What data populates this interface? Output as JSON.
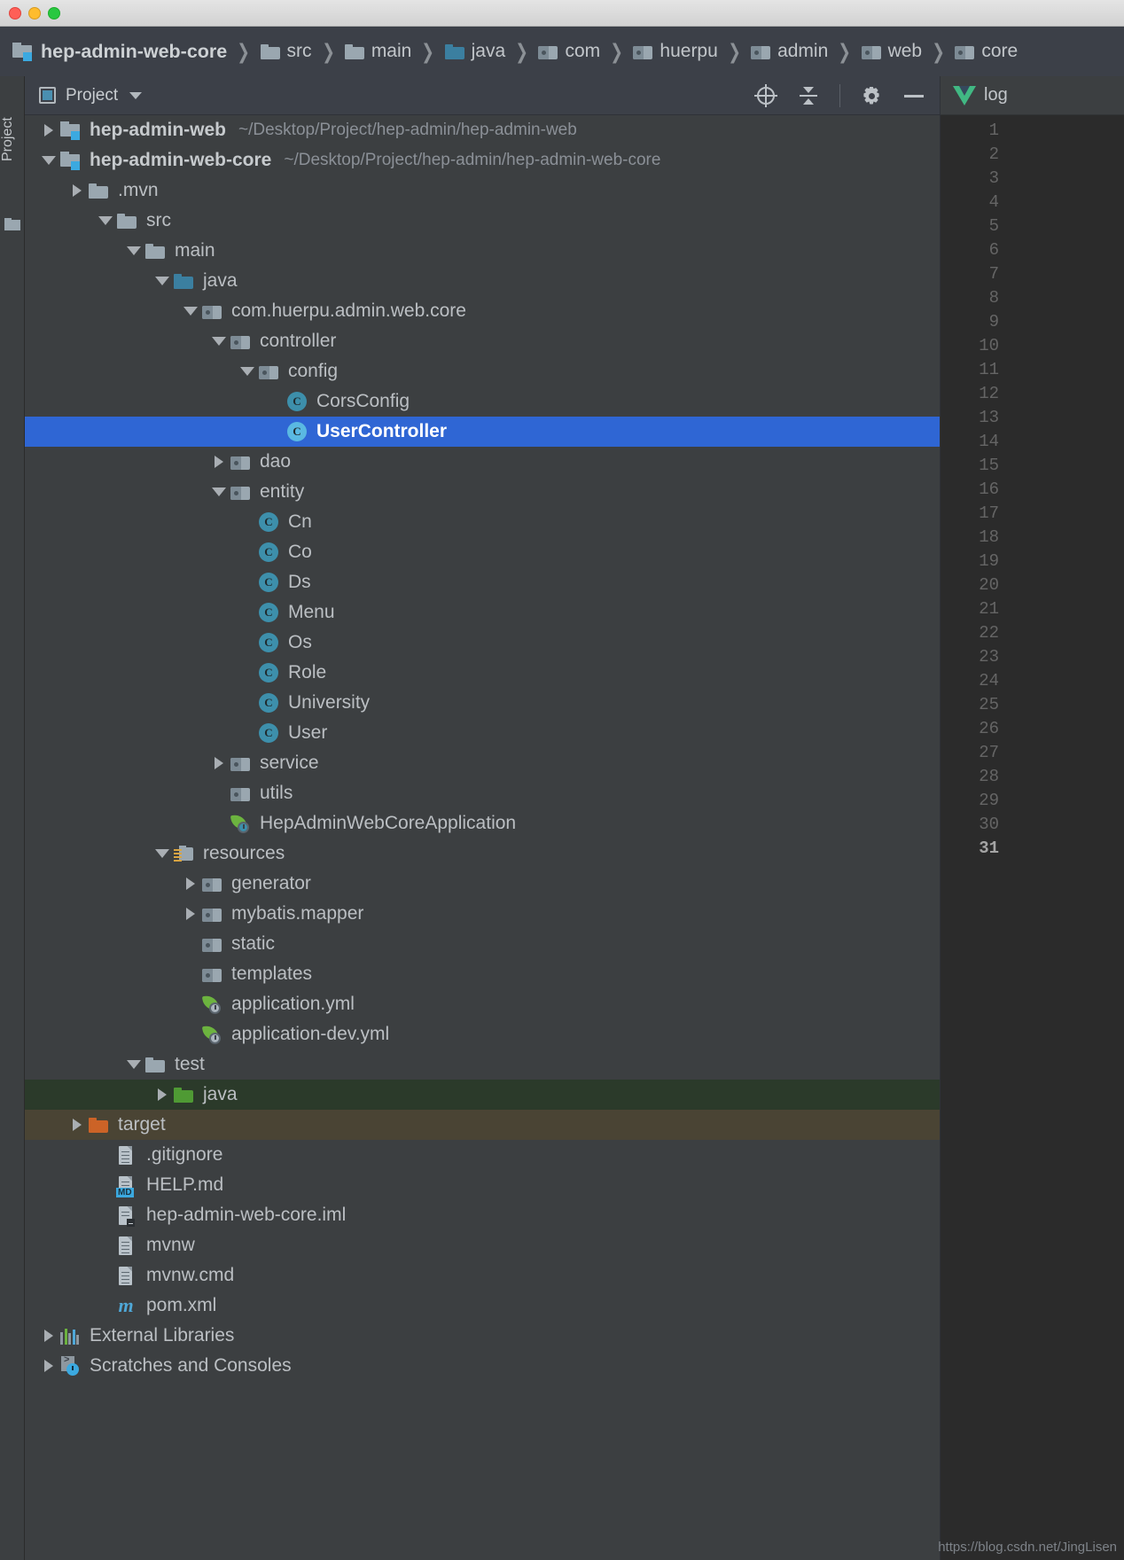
{
  "window": {
    "traffic_lights": [
      "close",
      "minimize",
      "zoom"
    ]
  },
  "breadcrumb": {
    "items": [
      {
        "label": "hep-admin-web-core",
        "icon": "module-icon",
        "root": true
      },
      {
        "label": "src",
        "icon": "folder-icon"
      },
      {
        "label": "main",
        "icon": "folder-icon"
      },
      {
        "label": "java",
        "icon": "source-folder-icon"
      },
      {
        "label": "com",
        "icon": "package-icon"
      },
      {
        "label": "huerpu",
        "icon": "package-icon"
      },
      {
        "label": "admin",
        "icon": "package-icon"
      },
      {
        "label": "web",
        "icon": "package-icon"
      },
      {
        "label": "core",
        "icon": "package-icon"
      }
    ],
    "separator": "❯"
  },
  "left_strip": {
    "tab_label": "Project"
  },
  "tool_window": {
    "title": "Project",
    "actions": [
      {
        "name": "locate-icon",
        "tooltip": "Select Opened File"
      },
      {
        "name": "collapse-all-icon",
        "tooltip": "Collapse All"
      },
      {
        "name": "gear-icon",
        "tooltip": "Settings"
      },
      {
        "name": "minimize-icon",
        "tooltip": "Hide"
      }
    ]
  },
  "tree": {
    "rows": [
      {
        "indent": 0,
        "arrow": "closed",
        "icon": "module-icon",
        "label": "hep-admin-web",
        "bold": true,
        "sub": "~/Desktop/Project/hep-admin/hep-admin-web"
      },
      {
        "indent": 0,
        "arrow": "open",
        "icon": "module-icon",
        "label": "hep-admin-web-core",
        "bold": true,
        "sub": "~/Desktop/Project/hep-admin/hep-admin-web-core"
      },
      {
        "indent": 1,
        "arrow": "closed",
        "icon": "folder-icon",
        "label": ".mvn"
      },
      {
        "indent": 2,
        "arrow": "open",
        "icon": "folder-icon",
        "label": "src"
      },
      {
        "indent": 3,
        "arrow": "open",
        "icon": "folder-icon",
        "label": "main"
      },
      {
        "indent": 4,
        "arrow": "open",
        "icon": "source-folder-icon",
        "label": "java"
      },
      {
        "indent": 5,
        "arrow": "open",
        "icon": "package-icon",
        "label": "com.huerpu.admin.web.core"
      },
      {
        "indent": 6,
        "arrow": "open",
        "icon": "package-icon",
        "label": "controller"
      },
      {
        "indent": 7,
        "arrow": "open",
        "icon": "package-icon",
        "label": "config"
      },
      {
        "indent": 8,
        "arrow": "none",
        "icon": "class-icon",
        "label": "CorsConfig"
      },
      {
        "indent": 8,
        "arrow": "none",
        "icon": "class-icon",
        "label": "UserController",
        "selected": true
      },
      {
        "indent": 6,
        "arrow": "closed",
        "icon": "package-icon",
        "label": "dao"
      },
      {
        "indent": 6,
        "arrow": "open",
        "icon": "package-icon",
        "label": "entity"
      },
      {
        "indent": 7,
        "arrow": "none",
        "icon": "class-icon",
        "label": "Cn"
      },
      {
        "indent": 7,
        "arrow": "none",
        "icon": "class-icon",
        "label": "Co"
      },
      {
        "indent": 7,
        "arrow": "none",
        "icon": "class-icon",
        "label": "Ds"
      },
      {
        "indent": 7,
        "arrow": "none",
        "icon": "class-icon",
        "label": "Menu"
      },
      {
        "indent": 7,
        "arrow": "none",
        "icon": "class-icon",
        "label": "Os"
      },
      {
        "indent": 7,
        "arrow": "none",
        "icon": "class-icon",
        "label": "Role"
      },
      {
        "indent": 7,
        "arrow": "none",
        "icon": "class-icon",
        "label": "University"
      },
      {
        "indent": 7,
        "arrow": "none",
        "icon": "class-icon",
        "label": "User"
      },
      {
        "indent": 6,
        "arrow": "closed",
        "icon": "package-icon",
        "label": "service"
      },
      {
        "indent": 6,
        "arrow": "none",
        "icon": "package-icon",
        "label": "utils"
      },
      {
        "indent": 6,
        "arrow": "none",
        "icon": "spring-boot-app-icon",
        "label": "HepAdminWebCoreApplication"
      },
      {
        "indent": 4,
        "arrow": "open",
        "icon": "resources-folder-icon",
        "label": "resources"
      },
      {
        "indent": 5,
        "arrow": "closed",
        "icon": "package-icon",
        "label": "generator"
      },
      {
        "indent": 5,
        "arrow": "closed",
        "icon": "package-icon",
        "label": "mybatis.mapper"
      },
      {
        "indent": 5,
        "arrow": "none",
        "icon": "package-icon",
        "label": "static"
      },
      {
        "indent": 5,
        "arrow": "none",
        "icon": "package-icon",
        "label": "templates"
      },
      {
        "indent": 5,
        "arrow": "none",
        "icon": "spring-yaml-icon",
        "label": "application.yml"
      },
      {
        "indent": 5,
        "arrow": "none",
        "icon": "spring-yaml-icon",
        "label": "application-dev.yml"
      },
      {
        "indent": 3,
        "arrow": "open",
        "icon": "folder-icon",
        "label": "test"
      },
      {
        "indent": 4,
        "arrow": "closed",
        "icon": "test-source-folder-icon",
        "label": "java",
        "context": "test"
      },
      {
        "indent": 1,
        "arrow": "closed",
        "icon": "excluded-folder-icon",
        "label": "target",
        "context": "target"
      },
      {
        "indent": 2,
        "arrow": "none",
        "icon": "file-icon",
        "label": ".gitignore"
      },
      {
        "indent": 2,
        "arrow": "none",
        "icon": "markdown-file-icon",
        "label": "HELP.md"
      },
      {
        "indent": 2,
        "arrow": "none",
        "icon": "iml-file-icon",
        "label": "hep-admin-web-core.iml"
      },
      {
        "indent": 2,
        "arrow": "none",
        "icon": "file-icon",
        "label": "mvnw"
      },
      {
        "indent": 2,
        "arrow": "none",
        "icon": "file-icon",
        "label": "mvnw.cmd"
      },
      {
        "indent": 2,
        "arrow": "none",
        "icon": "maven-file-icon",
        "label": "pom.xml"
      },
      {
        "indent": 0,
        "arrow": "closed",
        "icon": "external-libraries-icon",
        "label": "External Libraries"
      },
      {
        "indent": 0,
        "arrow": "closed",
        "icon": "scratches-icon",
        "label": "Scratches and Consoles"
      }
    ]
  },
  "editor": {
    "tab_label": "log",
    "tab_icon": "vue-file-icon",
    "line_numbers": [
      1,
      2,
      3,
      4,
      5,
      6,
      7,
      8,
      9,
      10,
      11,
      12,
      13,
      14,
      15,
      16,
      17,
      18,
      19,
      20,
      21,
      22,
      23,
      24,
      25,
      26,
      27,
      28,
      29,
      30,
      31
    ],
    "caret_line": 31
  },
  "watermark": "https://blog.csdn.net/JingLisen",
  "colors": {
    "selection_blue": "#2f66d4",
    "test_source_bg": "#2b3a2a",
    "excluded_bg": "#4a4434",
    "panel_bg": "#3c3f41",
    "header_bg": "#3c4048",
    "class_icon": "#3d8fab",
    "spring_green": "#6cb33f",
    "vue_green": "#41b883"
  }
}
